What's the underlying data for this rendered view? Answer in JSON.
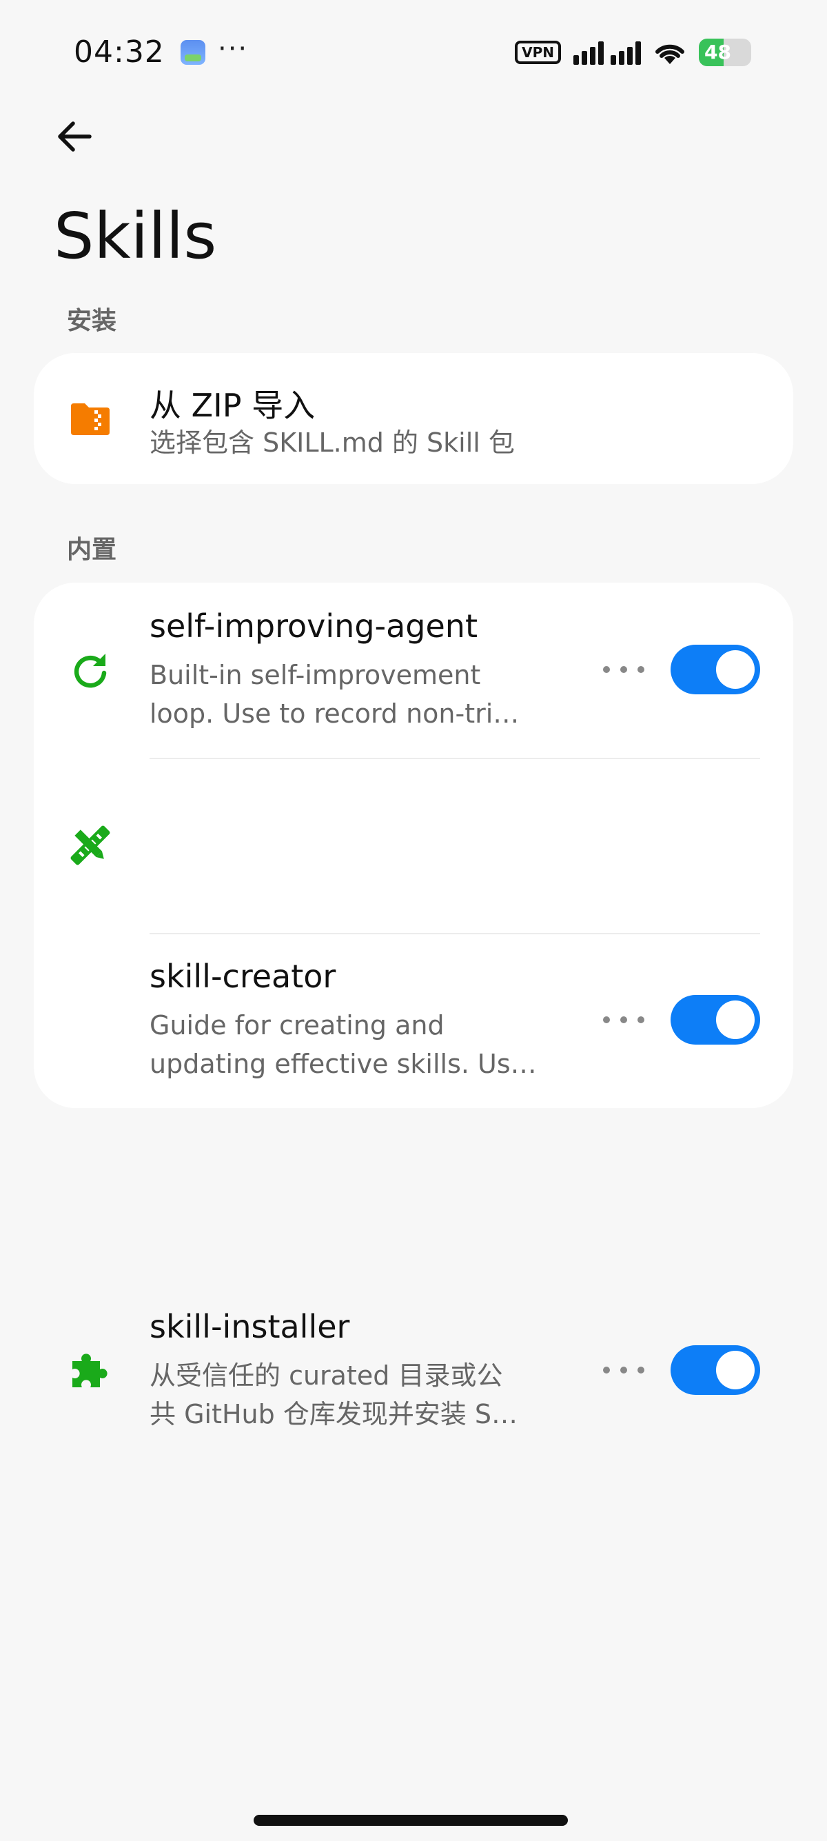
{
  "status_bar": {
    "time": "04:32",
    "more": "···",
    "vpn": "VPN",
    "battery": "48",
    "battery_level_pct": 48,
    "icons": [
      "app-icon",
      "vpn-icon",
      "signal-icon",
      "wifi-icon",
      "battery-icon"
    ]
  },
  "header": {
    "back_icon": "arrow-left-icon",
    "title": "Skills"
  },
  "install": {
    "section_label": "安装",
    "items": [
      {
        "icon": "folder-zip-icon",
        "icon_color": "#f57c00",
        "title": "从 ZIP 导入",
        "desc": "选择包含 SKILL.md 的 Skill 包"
      }
    ]
  },
  "builtin": {
    "section_label": "内置",
    "items": [
      {
        "icon": "refresh-icon",
        "icon_color": "#1aaa1a",
        "title": "self-improving-agent",
        "desc_line1": "Built-in self-improvement",
        "desc_line2": "loop. Use to record non-tri…",
        "enabled": true
      },
      {
        "icon": "pencil-ruler-icon",
        "icon_color": "#1aaa1a",
        "title": "skill-creator",
        "desc_line1": "Guide for creating and",
        "desc_line2": "updating effective skills. Us…",
        "enabled": true
      },
      {
        "icon": "puzzle-icon",
        "icon_color": "#1aaa1a",
        "title": "skill-installer",
        "desc_line1": "从受信任的 curated 目录或公",
        "desc_line2": "共 GitHub 仓库发现并安装 S…",
        "enabled": true
      }
    ]
  },
  "colors": {
    "accent": "#0d7ef7",
    "background": "#f7f7f7",
    "card": "#ffffff"
  }
}
